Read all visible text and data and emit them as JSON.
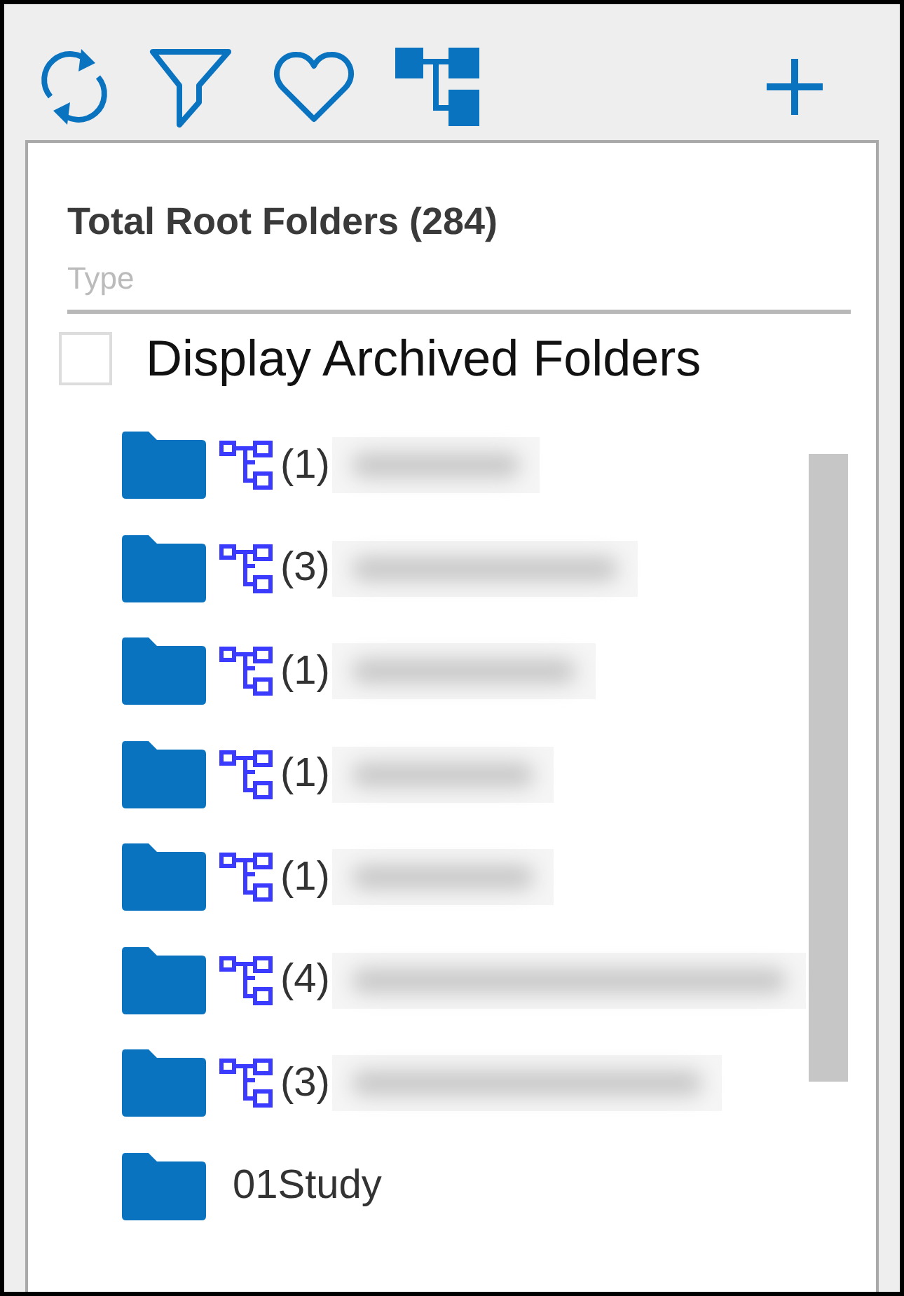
{
  "toolbar": {
    "buttons": [
      {
        "kind": "refresh"
      },
      {
        "kind": "filter"
      },
      {
        "kind": "favorite"
      },
      {
        "kind": "hierarchy"
      },
      {
        "kind": "add"
      }
    ]
  },
  "panel": {
    "title": "Total Root Folders (284)",
    "type_field": {
      "placeholder": "Type"
    },
    "archived_checkbox": {
      "label": "Display Archived Folders",
      "checked": false
    },
    "folders": [
      {
        "count": "(1)",
        "name_blurred": true
      },
      {
        "count": "(3)",
        "name_blurred": true
      },
      {
        "count": "(1)",
        "name_blurred": true
      },
      {
        "count": "(1)",
        "name_blurred": true
      },
      {
        "count": "(1)",
        "name_blurred": true
      },
      {
        "count": "(4)",
        "name_blurred": true
      },
      {
        "count": "(3)",
        "name_blurred": true
      },
      {
        "name": "01Study",
        "name_blurred": false
      }
    ]
  }
}
